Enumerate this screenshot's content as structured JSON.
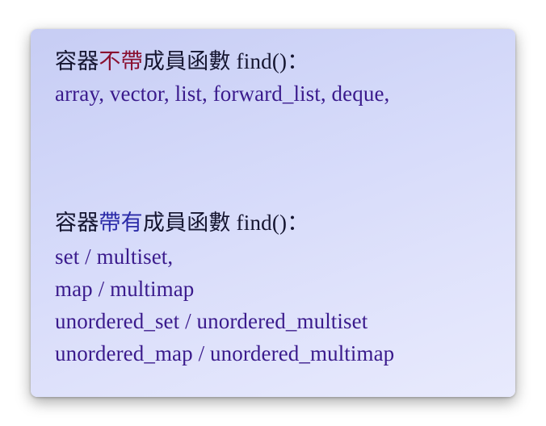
{
  "slide": {
    "section_without": {
      "prefix": "容器",
      "highlight": "不帶",
      "suffix": "成員函數 find()：",
      "containers": "array, vector, list, forward_list, deque,"
    },
    "section_with": {
      "prefix": "容器",
      "highlight": "帶有",
      "suffix": "成員函數 find()：",
      "containers": [
        "set / multiset,",
        "map / multimap",
        "unordered_set / unordered_multiset",
        "unordered_map / unordered_multimap"
      ]
    },
    "colors": {
      "background": "#d3d8f9",
      "highlight_without": "#8a1030",
      "highlight_with": "#2a2aa8",
      "container_text": "#3a1a8c"
    }
  }
}
